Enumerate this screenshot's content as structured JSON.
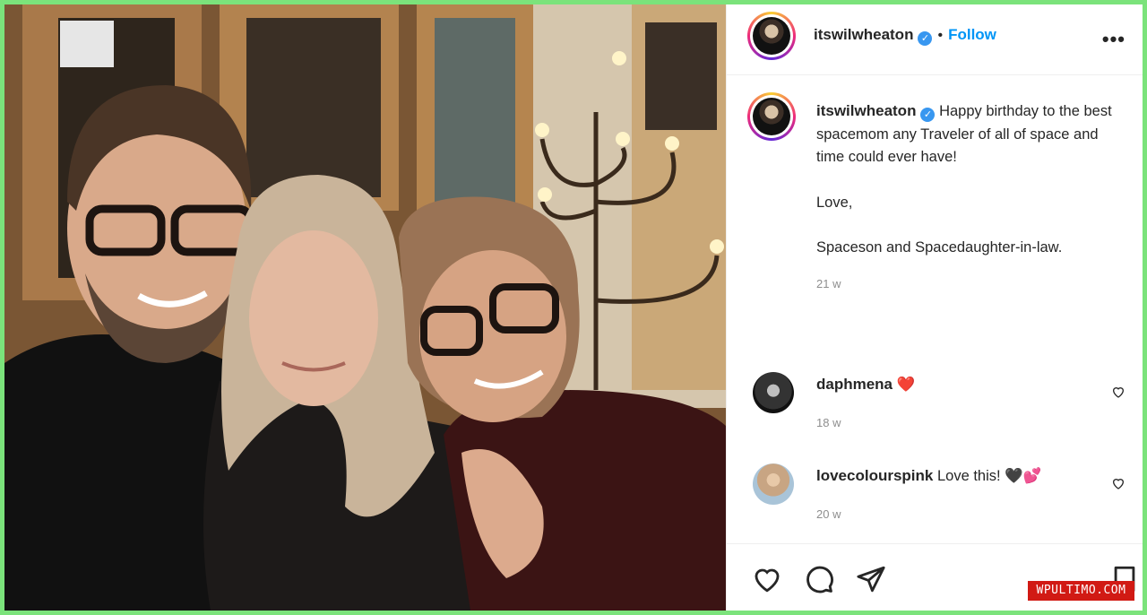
{
  "post": {
    "author": "itswilwheaton",
    "follow_label": "Follow",
    "separator": "•",
    "more_label": "•••",
    "verified_icon": "verified-badge-icon"
  },
  "caption": {
    "author": "itswilwheaton",
    "paragraphs": [
      "Happy birthday to the best spacemom any Traveler of all of space and time could ever have!",
      "Love,",
      "Spaceson and Spacedaughter-in-law."
    ],
    "time": "21 w"
  },
  "comments": [
    {
      "user": "daphmena",
      "text": "",
      "emoji": "❤️",
      "time": "18 w"
    },
    {
      "user": "lovecolourspink",
      "text": "Love this!",
      "emoji": "🖤💕",
      "time": "20 w"
    }
  ],
  "actions": {
    "icons": [
      "heart-icon",
      "comment-icon",
      "share-icon",
      "bookmark-icon"
    ]
  },
  "watermark": "WPULTIMO.COM",
  "colors": {
    "link": "#0095f6",
    "verified": "#3897f0",
    "heart": "#ed4956",
    "border": "#7be37b"
  }
}
